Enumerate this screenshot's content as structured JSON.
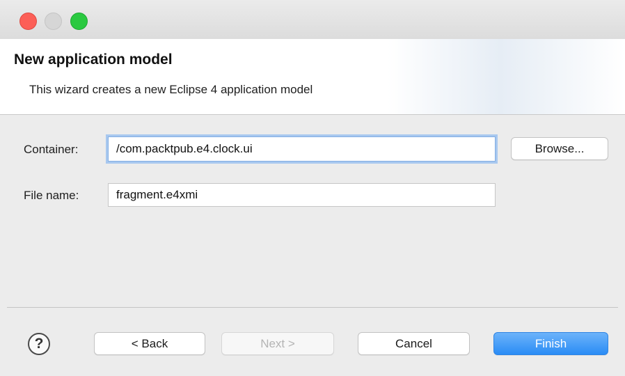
{
  "window": {
    "controls": [
      "close",
      "minimize",
      "zoom"
    ]
  },
  "header": {
    "title": "New application model",
    "description": "This wizard creates a new Eclipse 4 application model"
  },
  "form": {
    "container_label": "Container:",
    "container_value": "/com.packtpub.e4.clock.ui",
    "browse_label": "Browse...",
    "filename_label": "File name:",
    "filename_value": "fragment.e4xmi"
  },
  "footer": {
    "help_glyph": "?",
    "back_label": "< Back",
    "next_label": "Next >",
    "cancel_label": "Cancel",
    "finish_label": "Finish"
  },
  "colors": {
    "close": "#fc5f57",
    "minimize": "#d6d6d6",
    "zoom": "#2ac940",
    "primary": "#2a8cf5",
    "focus_ring": "#a8c8ef"
  }
}
